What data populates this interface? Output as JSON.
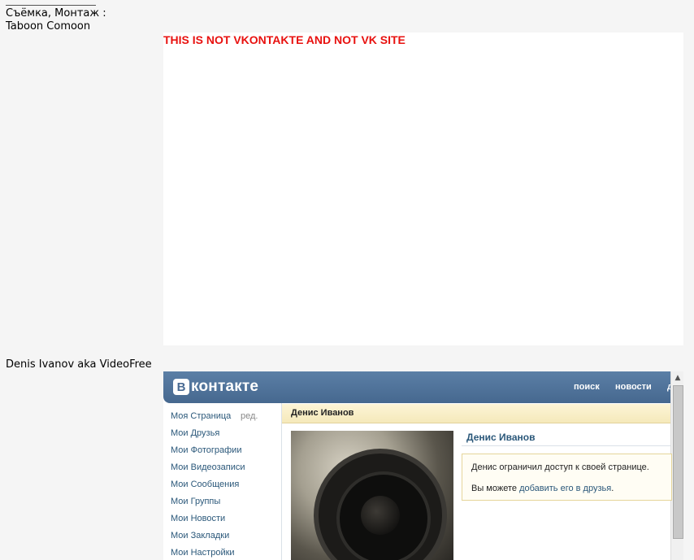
{
  "credits": {
    "line1": "Съёмка, Монтаж :",
    "line2": "Taboon Comoon"
  },
  "warning": "THIS IS NOT VKONTAKTE AND NOT VK SITE",
  "author": "Denis Ivanov aka VideoFree",
  "vk": {
    "logo_letter": "В",
    "logo_text": "контакте",
    "nav": {
      "search": "поиск",
      "news": "новости",
      "extra": "д"
    },
    "sidebar": {
      "edit": "ред.",
      "items": [
        "Моя Страница",
        "Мои Друзья",
        "Мои Фотографии",
        "Мои Видеозаписи",
        "Мои Сообщения",
        "Мои Группы",
        "Мои Новости",
        "Мои Закладки",
        "Мои Настройки"
      ]
    },
    "page_title": "Денис Иванов",
    "profile_name": "Денис Иванов",
    "notice": {
      "line1": "Денис ограничил доступ к своей странице.",
      "line2_prefix": "Вы можете ",
      "line2_link": "добавить его в друзья",
      "line2_suffix": "."
    }
  },
  "colors": {
    "warning": "#e8110f",
    "vk_header": "#46688f",
    "vk_link": "#2b587a"
  },
  "icons": {
    "scroll_up": "triangle-up"
  }
}
